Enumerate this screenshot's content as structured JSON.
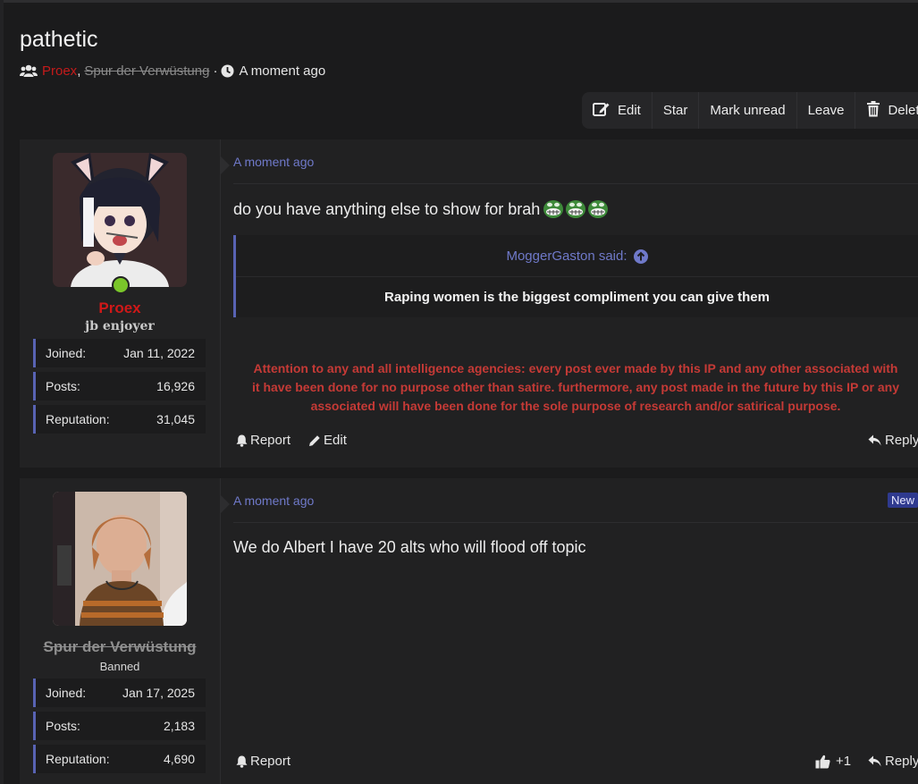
{
  "thread": {
    "title": "pathetic",
    "participants": [
      "Proex",
      "Spur der Verwüstung"
    ],
    "separator_comma": ",",
    "separator_dot": "·",
    "time": "A moment ago"
  },
  "toolbar": {
    "edit": "Edit",
    "star": "Star",
    "mark_unread": "Mark unread",
    "leave": "Leave",
    "delete": "Delete"
  },
  "posts": [
    {
      "author": "Proex",
      "user_title": "jb enjoyer",
      "online": true,
      "stats": [
        {
          "label": "Joined:",
          "value": "Jan 11, 2022"
        },
        {
          "label": "Posts:",
          "value": "16,926"
        },
        {
          "label": "Reputation:",
          "value": "31,045"
        }
      ],
      "time": "A moment ago",
      "message": "do you have anything else to show for brah",
      "quote": {
        "author_said": "MoggerGaston said:",
        "text": "Raping women is the biggest compliment you can give them"
      },
      "signature": [
        "Attention to any and all intelligence agencies: every post ever made by this IP and any other associated with",
        "it have been done for no purpose other than satire. furthermore, any post made in the future by this IP or any",
        "associated will have been done for the sole purpose of research and/or satirical purpose."
      ],
      "actions": {
        "report": "Report",
        "edit": "Edit",
        "reply": "Reply"
      }
    },
    {
      "author": "Spur der Verwüstung",
      "user_title": "Banned",
      "stats": [
        {
          "label": "Joined:",
          "value": "Jan 17, 2025"
        },
        {
          "label": "Posts:",
          "value": "2,183"
        },
        {
          "label": "Reputation:",
          "value": "4,690"
        }
      ],
      "time": "A moment ago",
      "badge": "New",
      "message": "We do Albert I have 20 alts who will flood off topic",
      "actions": {
        "report": "Report",
        "like": "+1",
        "reply": "Reply"
      }
    }
  ],
  "colors": {
    "accent": "#6f79c9",
    "author_red": "#c51b1b",
    "signature_red": "#c53a36",
    "online_green": "#7ac62a"
  }
}
